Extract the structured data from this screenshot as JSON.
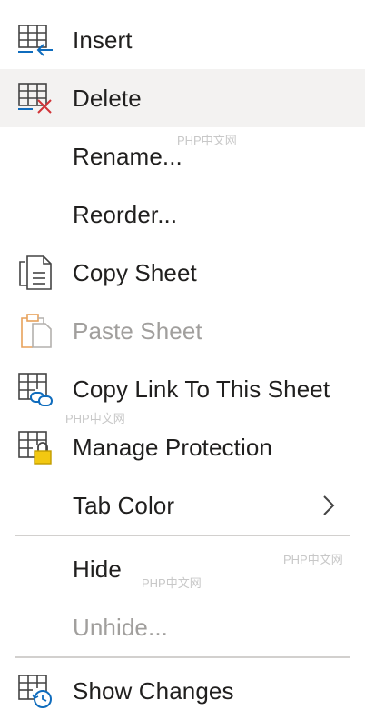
{
  "menu": {
    "items": [
      {
        "id": "insert",
        "label": "Insert",
        "icon": "table-insert-icon",
        "disabled": false,
        "hovered": false
      },
      {
        "id": "delete",
        "label": "Delete",
        "icon": "table-delete-icon",
        "disabled": false,
        "hovered": true
      },
      {
        "id": "rename",
        "label": "Rename...",
        "icon": null,
        "disabled": false,
        "hovered": false
      },
      {
        "id": "reorder",
        "label": "Reorder...",
        "icon": null,
        "disabled": false,
        "hovered": false
      },
      {
        "id": "copy-sheet",
        "label": "Copy Sheet",
        "icon": "copy-sheet-icon",
        "disabled": false,
        "hovered": false
      },
      {
        "id": "paste-sheet",
        "label": "Paste Sheet",
        "icon": "paste-sheet-icon",
        "disabled": true,
        "hovered": false
      },
      {
        "id": "copy-link",
        "label": "Copy Link To This Sheet",
        "icon": "sheet-link-icon",
        "disabled": false,
        "hovered": false
      },
      {
        "id": "manage-protection",
        "label": "Manage Protection",
        "icon": "sheet-lock-icon",
        "disabled": false,
        "hovered": false
      },
      {
        "id": "tab-color",
        "label": "Tab Color",
        "icon": null,
        "disabled": false,
        "hovered": false,
        "submenu": "chevron-right-icon"
      },
      {
        "id": "hide",
        "label": "Hide",
        "icon": null,
        "disabled": false,
        "hovered": false
      },
      {
        "id": "unhide",
        "label": "Unhide...",
        "icon": null,
        "disabled": true,
        "hovered": false
      },
      {
        "id": "show-changes",
        "label": "Show Changes",
        "icon": "sheet-history-icon",
        "disabled": false,
        "hovered": false
      }
    ]
  },
  "watermark": {
    "text": "PHP中文网"
  },
  "colors": {
    "hover_background": "#f3f2f1",
    "text": "#201f1e",
    "disabled_text": "#a19f9d",
    "divider": "#d2d0ce",
    "accent_blue": "#0f6cbd",
    "delete_red": "#d13438",
    "lock_gold": "#c19c00",
    "paste_orange": "#e8a15a"
  }
}
